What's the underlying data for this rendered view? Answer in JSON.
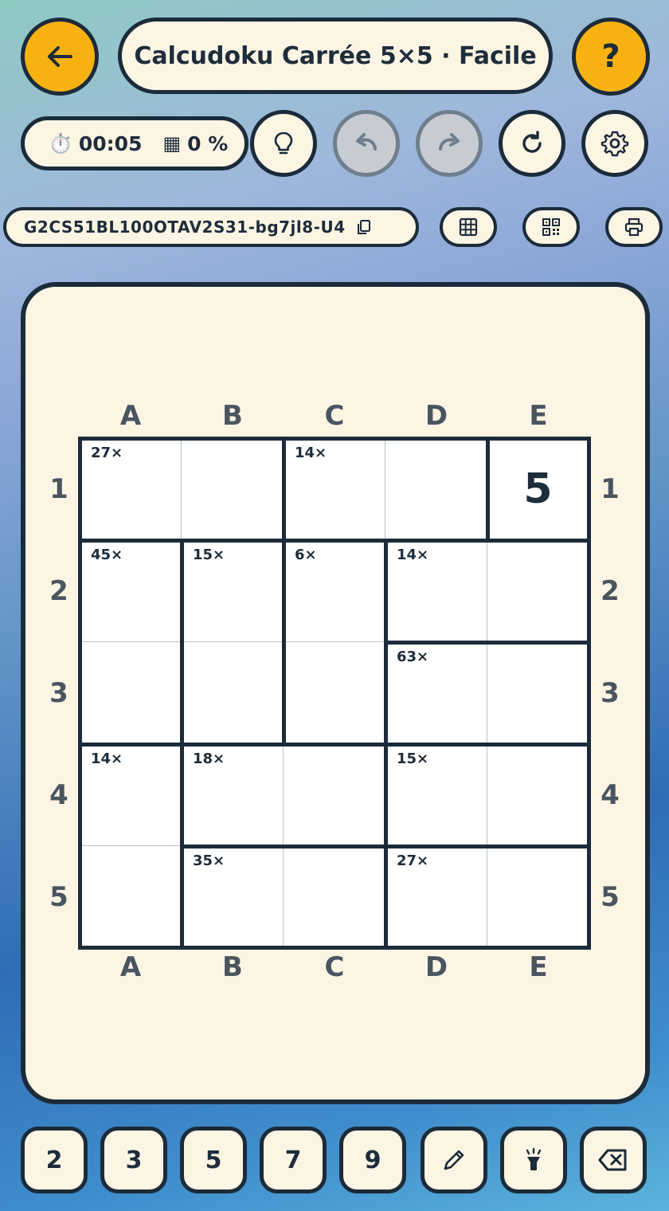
{
  "header": {
    "title": "Calcudoku Carrée 5×5 · Facile",
    "timer": "00:05",
    "progress": "0 %",
    "puzzle_code": "G2CS51BL100OTAV2S31-bg7jl8-U4"
  },
  "icons": {
    "back": "arrow-left-icon",
    "help": "?",
    "timer": "⏱️",
    "progress": "▦"
  },
  "colors": {
    "accent": "#f7b212",
    "dark": "#1b2b3a",
    "card": "#fdf5e4"
  },
  "board": {
    "columns": [
      "A",
      "B",
      "C",
      "D",
      "E"
    ],
    "rows": [
      "1",
      "2",
      "3",
      "4",
      "5"
    ],
    "cages": [
      {
        "label": "27×",
        "cells": [
          [
            0,
            0
          ],
          [
            0,
            1
          ]
        ]
      },
      {
        "label": "14×",
        "cells": [
          [
            0,
            2
          ],
          [
            0,
            3
          ]
        ]
      },
      {
        "label": "",
        "cells": [
          [
            0,
            4
          ]
        ]
      },
      {
        "label": "45×",
        "cells": [
          [
            1,
            0
          ],
          [
            2,
            0
          ]
        ]
      },
      {
        "label": "15×",
        "cells": [
          [
            1,
            1
          ],
          [
            2,
            1
          ]
        ]
      },
      {
        "label": "6×",
        "cells": [
          [
            1,
            2
          ],
          [
            2,
            2
          ]
        ]
      },
      {
        "label": "14×",
        "cells": [
          [
            1,
            3
          ],
          [
            1,
            4
          ]
        ]
      },
      {
        "label": "63×",
        "cells": [
          [
            2,
            3
          ],
          [
            2,
            4
          ]
        ]
      },
      {
        "label": "14×",
        "cells": [
          [
            3,
            0
          ],
          [
            4,
            0
          ]
        ]
      },
      {
        "label": "18×",
        "cells": [
          [
            3,
            1
          ],
          [
            3,
            2
          ]
        ]
      },
      {
        "label": "15×",
        "cells": [
          [
            3,
            3
          ],
          [
            3,
            4
          ]
        ]
      },
      {
        "label": "35×",
        "cells": [
          [
            4,
            1
          ],
          [
            4,
            2
          ]
        ]
      },
      {
        "label": "27×",
        "cells": [
          [
            4,
            3
          ],
          [
            4,
            4
          ]
        ]
      }
    ],
    "values": [
      [
        "",
        "",
        "",
        "",
        "5"
      ],
      [
        "",
        "",
        "",
        "",
        ""
      ],
      [
        "",
        "",
        "",
        "",
        ""
      ],
      [
        "",
        "",
        "",
        "",
        ""
      ],
      [
        "",
        "",
        "",
        "",
        ""
      ]
    ]
  },
  "keypad": {
    "numbers": [
      "2",
      "3",
      "5",
      "7",
      "9"
    ]
  }
}
